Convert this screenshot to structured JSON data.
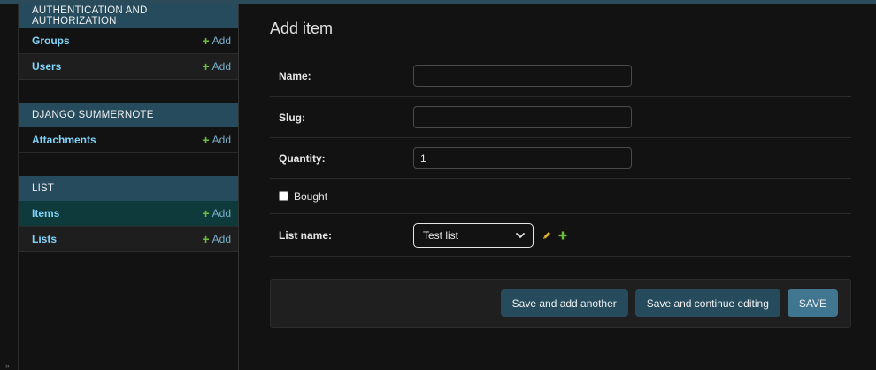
{
  "sidebar": {
    "modules": [
      {
        "title": "AUTHENTICATION AND AUTHORIZATION",
        "items": [
          {
            "label": "Groups",
            "add": "Add"
          },
          {
            "label": "Users",
            "add": "Add"
          }
        ]
      },
      {
        "title": "DJANGO SUMMERNOTE",
        "items": [
          {
            "label": "Attachments",
            "add": "Add"
          }
        ]
      },
      {
        "title": "LIST",
        "items": [
          {
            "label": "Items",
            "add": "Add"
          },
          {
            "label": "Lists",
            "add": "Add"
          }
        ]
      }
    ]
  },
  "page": {
    "title": "Add item"
  },
  "form": {
    "name_label": "Name:",
    "name_value": "",
    "slug_label": "Slug:",
    "slug_value": "",
    "quantity_label": "Quantity:",
    "quantity_value": "1",
    "bought_label": "Bought",
    "list_label": "List name:",
    "list_value": "Test list"
  },
  "actions": {
    "save_add_another": "Save and add another",
    "save_continue": "Save and continue editing",
    "save": "SAVE"
  },
  "colors": {
    "header": "#264b5d",
    "link": "#81d4fa",
    "add_plus": "#6dbd3f",
    "primary_button": "#417690"
  },
  "icons": [
    "plus-icon",
    "pencil-icon",
    "chevron-down-icon"
  ]
}
